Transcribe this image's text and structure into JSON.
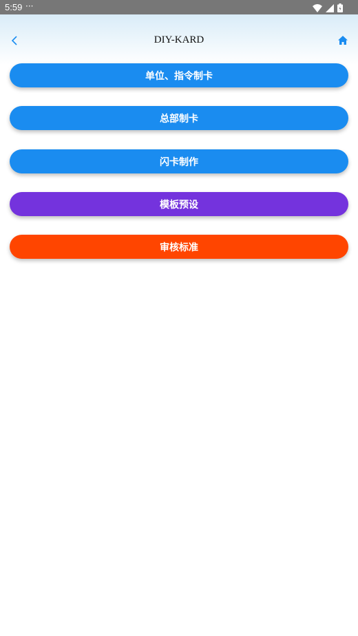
{
  "status_bar": {
    "time": "5:59",
    "dots": "···",
    "icons": [
      "wifi-icon",
      "cell-signal-icon",
      "battery-icon"
    ]
  },
  "header": {
    "title": "DIY-KARD",
    "back_icon": "chevron-left-icon",
    "home_icon": "home-icon",
    "accent_color": "#1a8cf0"
  },
  "menu": {
    "items": [
      {
        "label": "单位、指令制卡",
        "color": "#1a8cf0"
      },
      {
        "label": "总部制卡",
        "color": "#1a8cf0"
      },
      {
        "label": "闪卡制作",
        "color": "#1a8cf0"
      },
      {
        "label": "模板预设",
        "color": "#7433dd"
      },
      {
        "label": "审核标准",
        "color": "#ff4500"
      }
    ]
  }
}
